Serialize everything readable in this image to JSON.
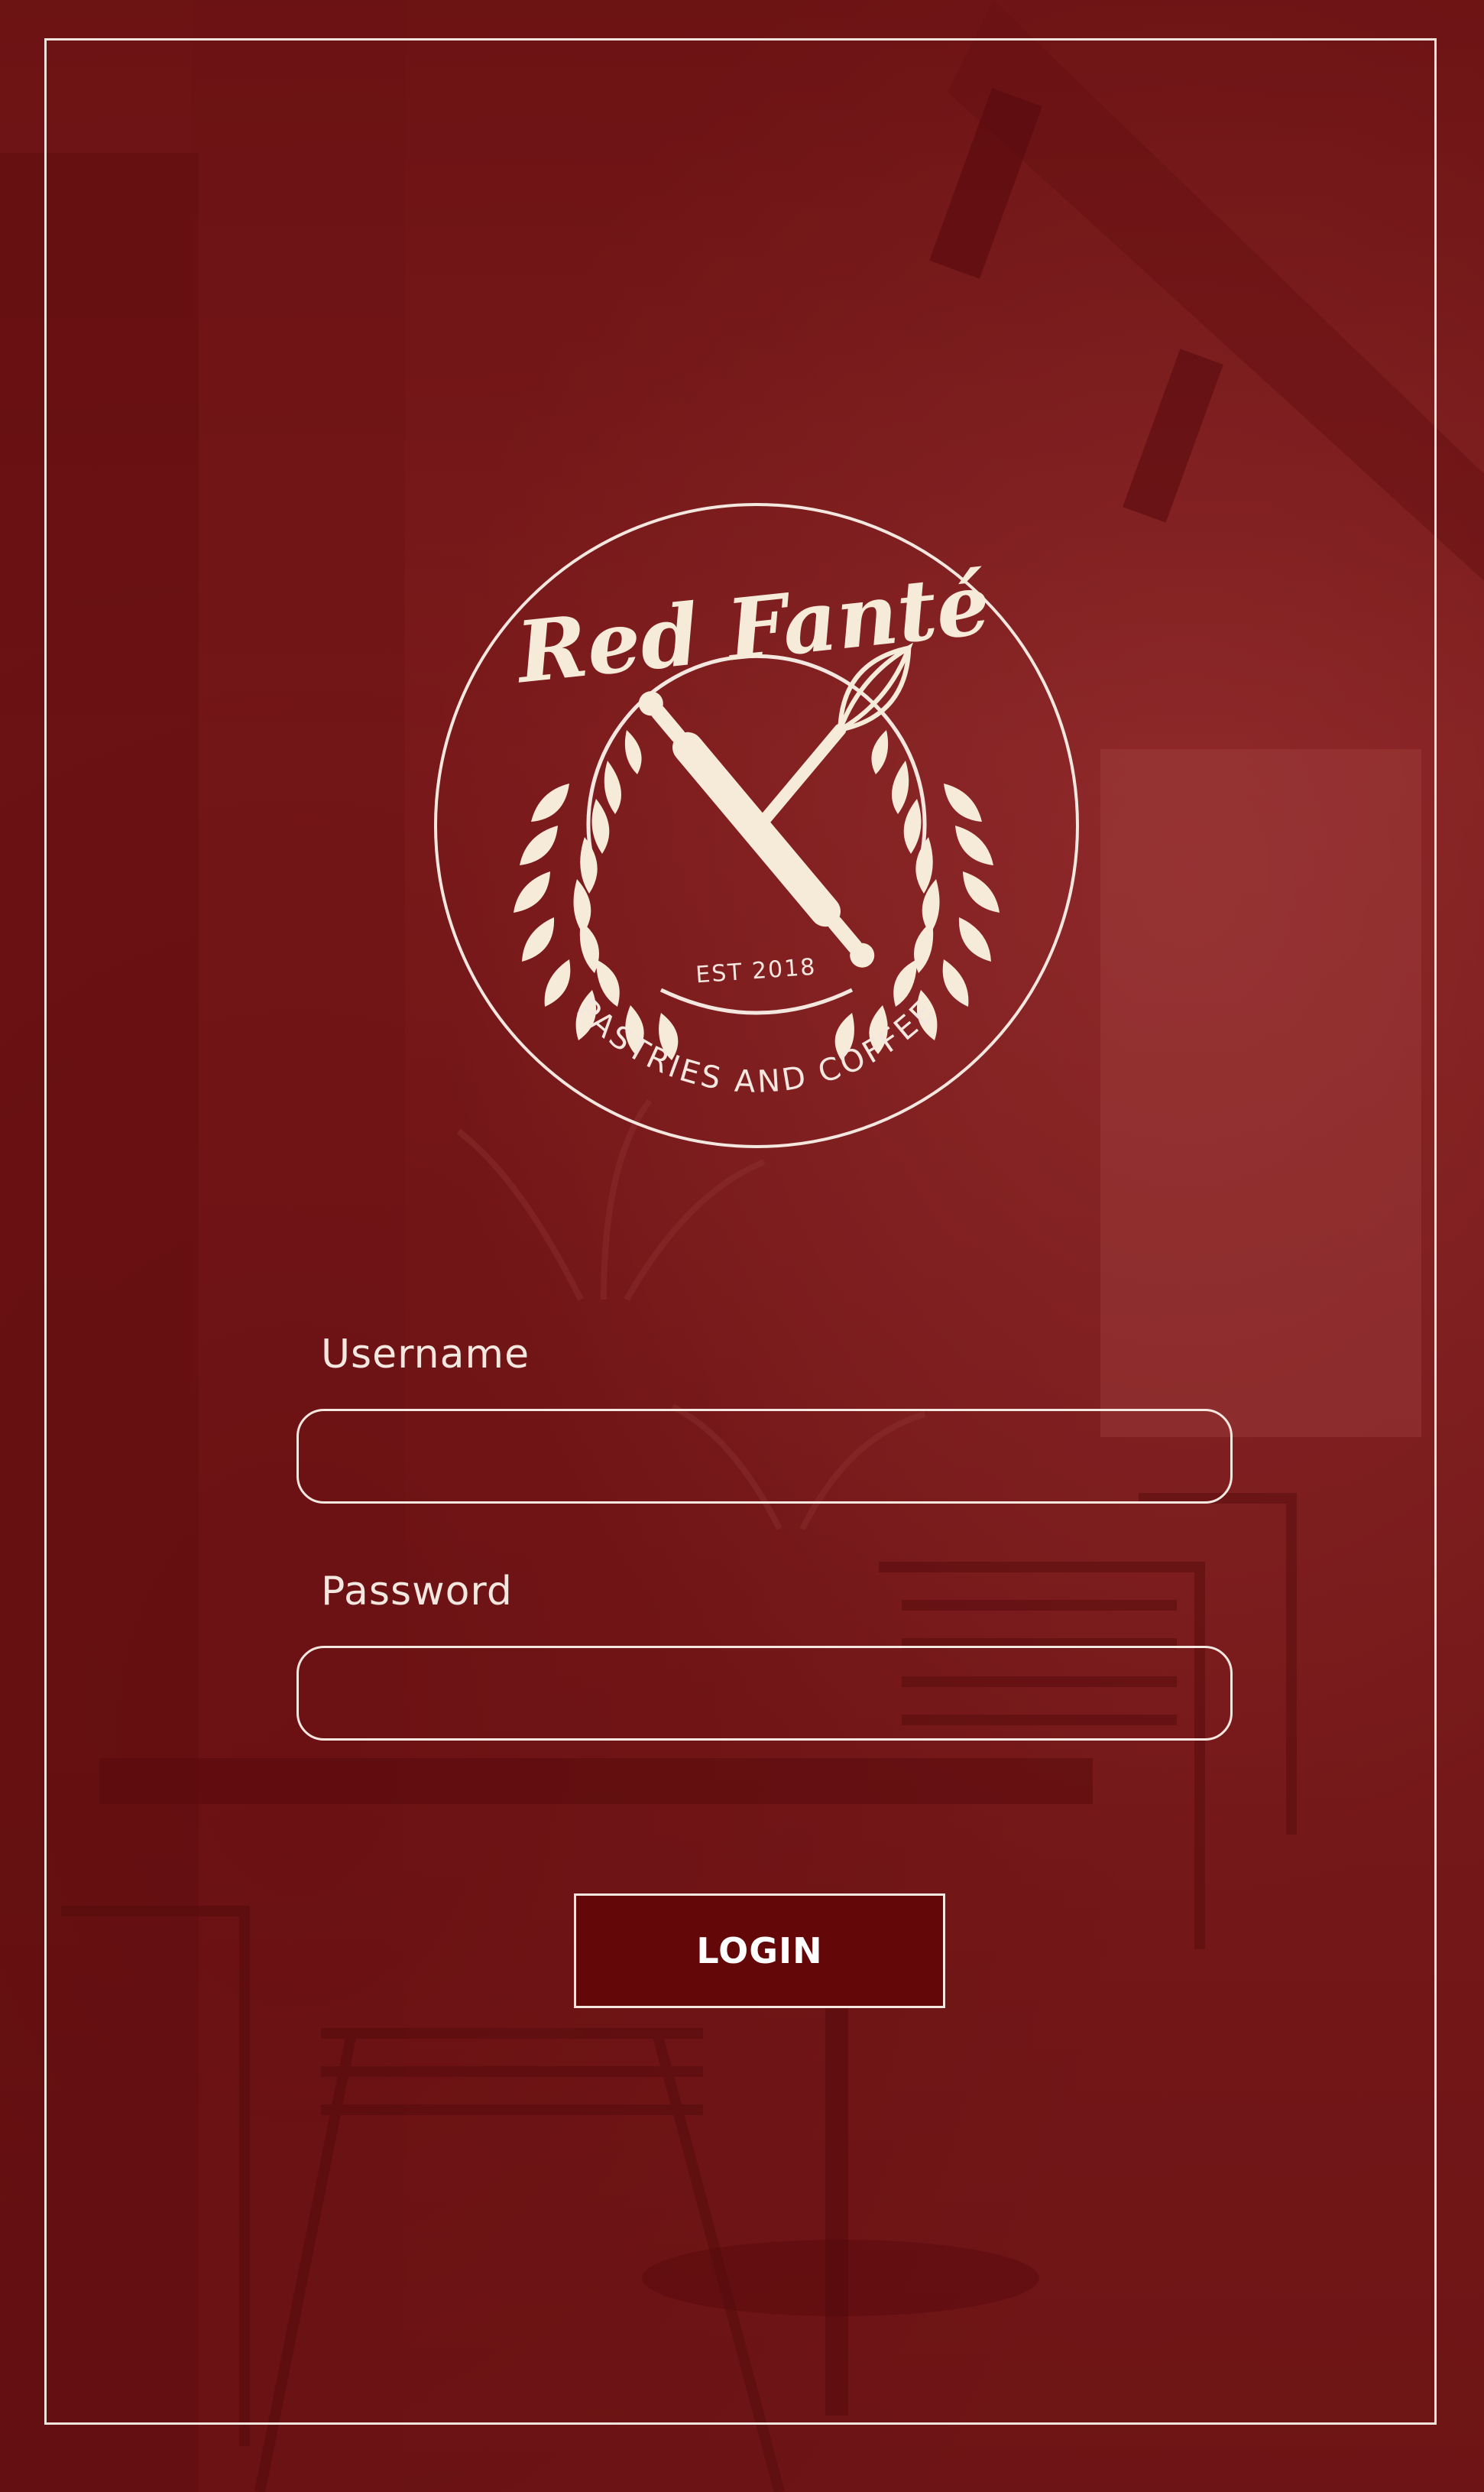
{
  "logo": {
    "brand_name": "Red Fanté",
    "established": "EST 2018",
    "tagline": "PASTRIES AND COFFEE"
  },
  "form": {
    "username_label": "Username",
    "username_value": "",
    "password_label": "Password",
    "password_value": "",
    "login_label": "LOGIN"
  },
  "colors": {
    "background": "#7b1b1c",
    "button": "#640708",
    "foreground": "#f3e7df"
  }
}
